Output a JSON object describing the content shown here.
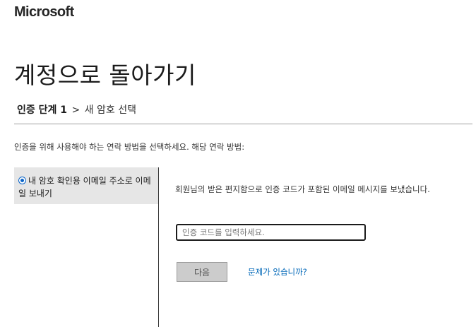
{
  "header": {
    "logo_text": "Microsoft"
  },
  "page": {
    "title": "계정으로 돌아가기"
  },
  "breadcrumb": {
    "current": "인증 단계 1",
    "separator": ">",
    "next": "새 암호 선택"
  },
  "instruction": "인증을 위해 사용해야 하는 연락 방법을 선택하세요. 해당 연락 방법:",
  "contact_options": [
    {
      "label": "내 암호 확인용 이메일 주소로 이메일 보내기",
      "selected": true
    }
  ],
  "panel": {
    "message": "회원님의 받은 편지함으로 인증 코드가 포함된 이메일 메시지를 보냈습니다.",
    "code_input": {
      "placeholder": "인증 코드를 입력하세요.",
      "value": ""
    },
    "next_button_label": "다음",
    "help_link_label": "문제가 있습니까?"
  },
  "colors": {
    "accent": "#0067b8",
    "option_background": "#e6e6e6",
    "button_disabled_background": "#cccccc"
  },
  "icons": {
    "radio": "radio-selected-icon"
  }
}
